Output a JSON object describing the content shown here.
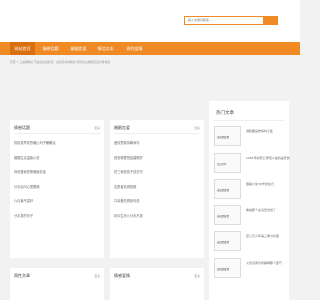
{
  "search": {
    "placeholder": "输入关键词搜索..."
  },
  "nav": [
    "网站首页",
    "情感话题",
    "婚姻恋爱",
    "情话文本",
    "两性爱情"
  ],
  "breadcrumb": "首页 > 口是理解心不是说出来的话，这段话非常精彩/长情告白婚姻恋爱文章情感",
  "card_left": {
    "title": "情感话题",
    "more": "更多",
    "items": [
      "情侣说早安的暖心句子暖暖话",
      "婚姻生活温馨小说",
      "你说爱我的夜晚面情话",
      "分手后叫心很累痛",
      "六月暑气甚好",
      "分手发的句子"
    ]
  },
  "card_mid": {
    "title": "婚姻恋爱",
    "more": "更多",
    "items": [
      "爱情里真情瞬间句",
      "西安哪里拍结婚照好",
      "初三我说孩子该念书",
      "志愿者情感视频",
      "口诗爱情感到句说",
      "初中生怎么分手不哭"
    ]
  },
  "card_bl": {
    "title": "两性文章",
    "more": "更多"
  },
  "card_bm": {
    "title": "情感爱情",
    "more": "更多"
  },
  "sidebar": {
    "title": "热门文章",
    "items": [
      {
        "thumb": "这就是爱情",
        "text": "满脸都是伤情句子集"
      },
      {
        "thumb": "日记写作",
        "text": "1981年的死亡男阳人说的是悲伤"
      },
      {
        "thumb": "这就是爱情",
        "text": "跟着少女30岁的生日"
      },
      {
        "thumb": "这就是爱情",
        "text": "重启那个女演员去世了"
      },
      {
        "thumb": "这就是爱情",
        "text": "花儿与少年第三季分享量"
      },
      {
        "thumb": "这就是爱情",
        "text": "火影忍者为何解释那个霸气"
      }
    ]
  }
}
